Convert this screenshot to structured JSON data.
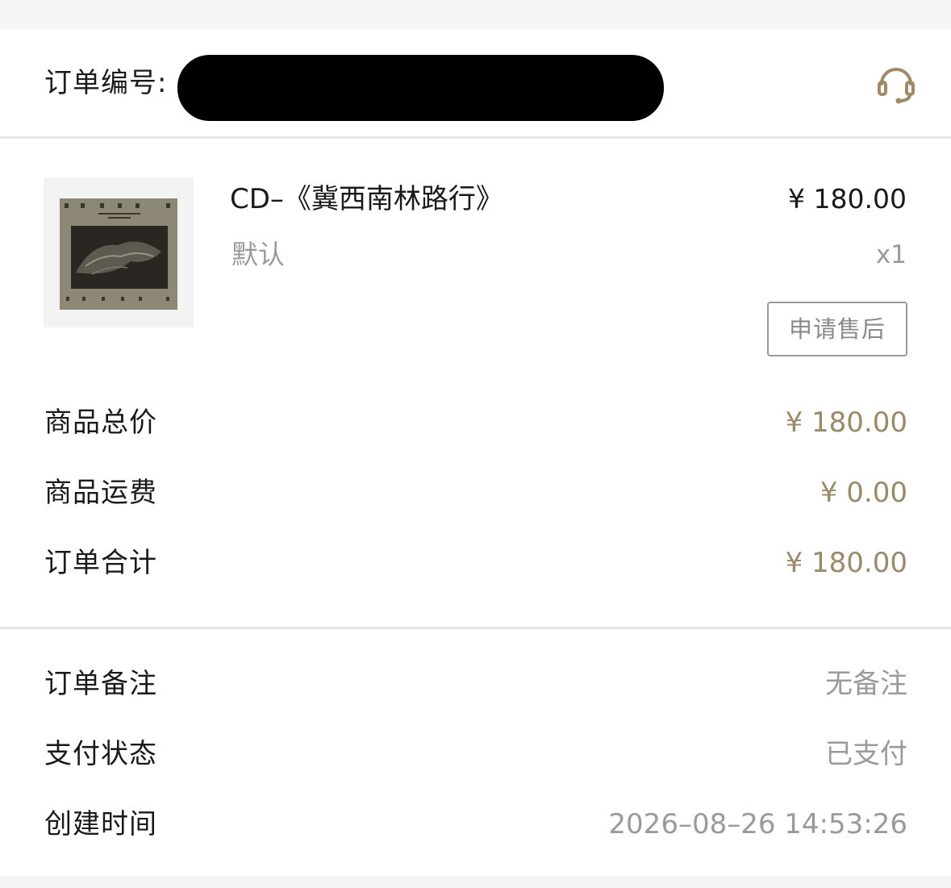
{
  "header": {
    "order_label": "订单编号:",
    "support_icon": "headset-icon"
  },
  "product": {
    "name": "CD–《冀西南林路行》",
    "variant": "默认",
    "price": "¥ 180.00",
    "quantity": "x1",
    "aftersale_label": "申请售后"
  },
  "summary": [
    {
      "label": "商品总价",
      "value": "¥ 180.00"
    },
    {
      "label": "商品运费",
      "value": "¥ 0.00"
    },
    {
      "label": "订单合计",
      "value": "¥ 180.00"
    }
  ],
  "details": [
    {
      "label": "订单备注",
      "value": "无备注"
    },
    {
      "label": "支付状态",
      "value": "已支付"
    },
    {
      "label": "创建时间",
      "value": "2026–08–26 14:53:26"
    }
  ],
  "colors": {
    "accent_gold": "#9a8a6a",
    "muted_text": "#9a9a9a",
    "primary_text": "#1a1a1a"
  }
}
